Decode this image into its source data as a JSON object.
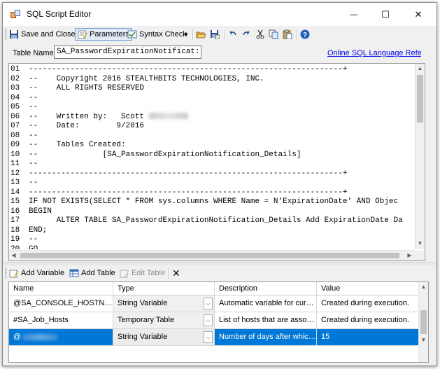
{
  "window": {
    "title": "SQL Script Editor",
    "minimize_glyph": "—",
    "maximize_glyph": "☐",
    "close_glyph": "✕"
  },
  "toolbar": {
    "save_close_label": "Save and Close",
    "parameters_label": "Parameters",
    "syntax_check_label": "Syntax Check",
    "syntax_dropdown_glyph": "▾",
    "icons": [
      "save-icon",
      "parameters-icon",
      "syntax-check-icon",
      "open-folder-icon",
      "save-as-icon",
      "undo-icon",
      "redo-icon",
      "cut-icon",
      "copy-icon",
      "paste-icon",
      "help-icon"
    ]
  },
  "table_name": {
    "label": "Table Name:",
    "value": "SA_PasswordExpirationNotificat:"
  },
  "reference_link": "Online SQL Language Referenc",
  "editor": {
    "lines": [
      {
        "num": "01",
        "text": "--------------------------------------------------------------------+"
      },
      {
        "num": "02",
        "text": "--    Copyright 2016 STEALTHBITS TECHNOLOGIES, INC."
      },
      {
        "num": "03",
        "text": "--    ALL RIGHTS RESERVED"
      },
      {
        "num": "04",
        "text": "--"
      },
      {
        "num": "05",
        "text": "--"
      },
      {
        "num": "06",
        "text": "--    Written by:   Scott "
      },
      {
        "num": "07",
        "text": "--    Date:        9/2016"
      },
      {
        "num": "08",
        "text": "--"
      },
      {
        "num": "09",
        "text": "--    Tables Created:"
      },
      {
        "num": "10",
        "text": "--              [SA_PasswordExpirationNotification_Details]"
      },
      {
        "num": "11",
        "text": "--"
      },
      {
        "num": "12",
        "text": "--------------------------------------------------------------------+"
      },
      {
        "num": "13",
        "text": "--"
      },
      {
        "num": "14",
        "text": "--------------------------------------------------------------------+"
      },
      {
        "num": "15",
        "text": "IF NOT EXISTS(SELECT * FROM sys.columns WHERE Name = N'ExpirationDate' AND Objec"
      },
      {
        "num": "16",
        "text": "BEGIN"
      },
      {
        "num": "17",
        "text": "      ALTER TABLE SA_PasswordExpirationNotification_Details Add ExpirationDate Da"
      },
      {
        "num": "18",
        "text": "END;"
      },
      {
        "num": "19",
        "text": "--"
      },
      {
        "num": "20",
        "text": "GO"
      },
      {
        "num": "21",
        "text": ""
      }
    ]
  },
  "params_toolbar": {
    "add_variable_label": "Add Variable",
    "add_table_label": "Add Table",
    "edit_table_label": "Edit Table",
    "delete_glyph": "✕"
  },
  "grid": {
    "headers": [
      "Name",
      "Type",
      "Description",
      "Value"
    ],
    "rows": [
      {
        "name": "@SA_CONSOLE_HOSTNAME",
        "type": "String Variable",
        "description": "Automatic variable for current co...",
        "value": "Created during execution.",
        "selected": false
      },
      {
        "name": "#SA_Job_Hosts",
        "type": "Temporary Table",
        "description": "List of hosts that are associated ...",
        "value": "Created during execution.",
        "selected": false
      },
      {
        "name": "@",
        "type": "String Variable",
        "description": "Number of days after which a pa...",
        "value": "15",
        "selected": true
      }
    ]
  },
  "colors": {
    "selection": "#0078d7",
    "link": "#0000ee",
    "chrome": "#f0f0f0"
  }
}
